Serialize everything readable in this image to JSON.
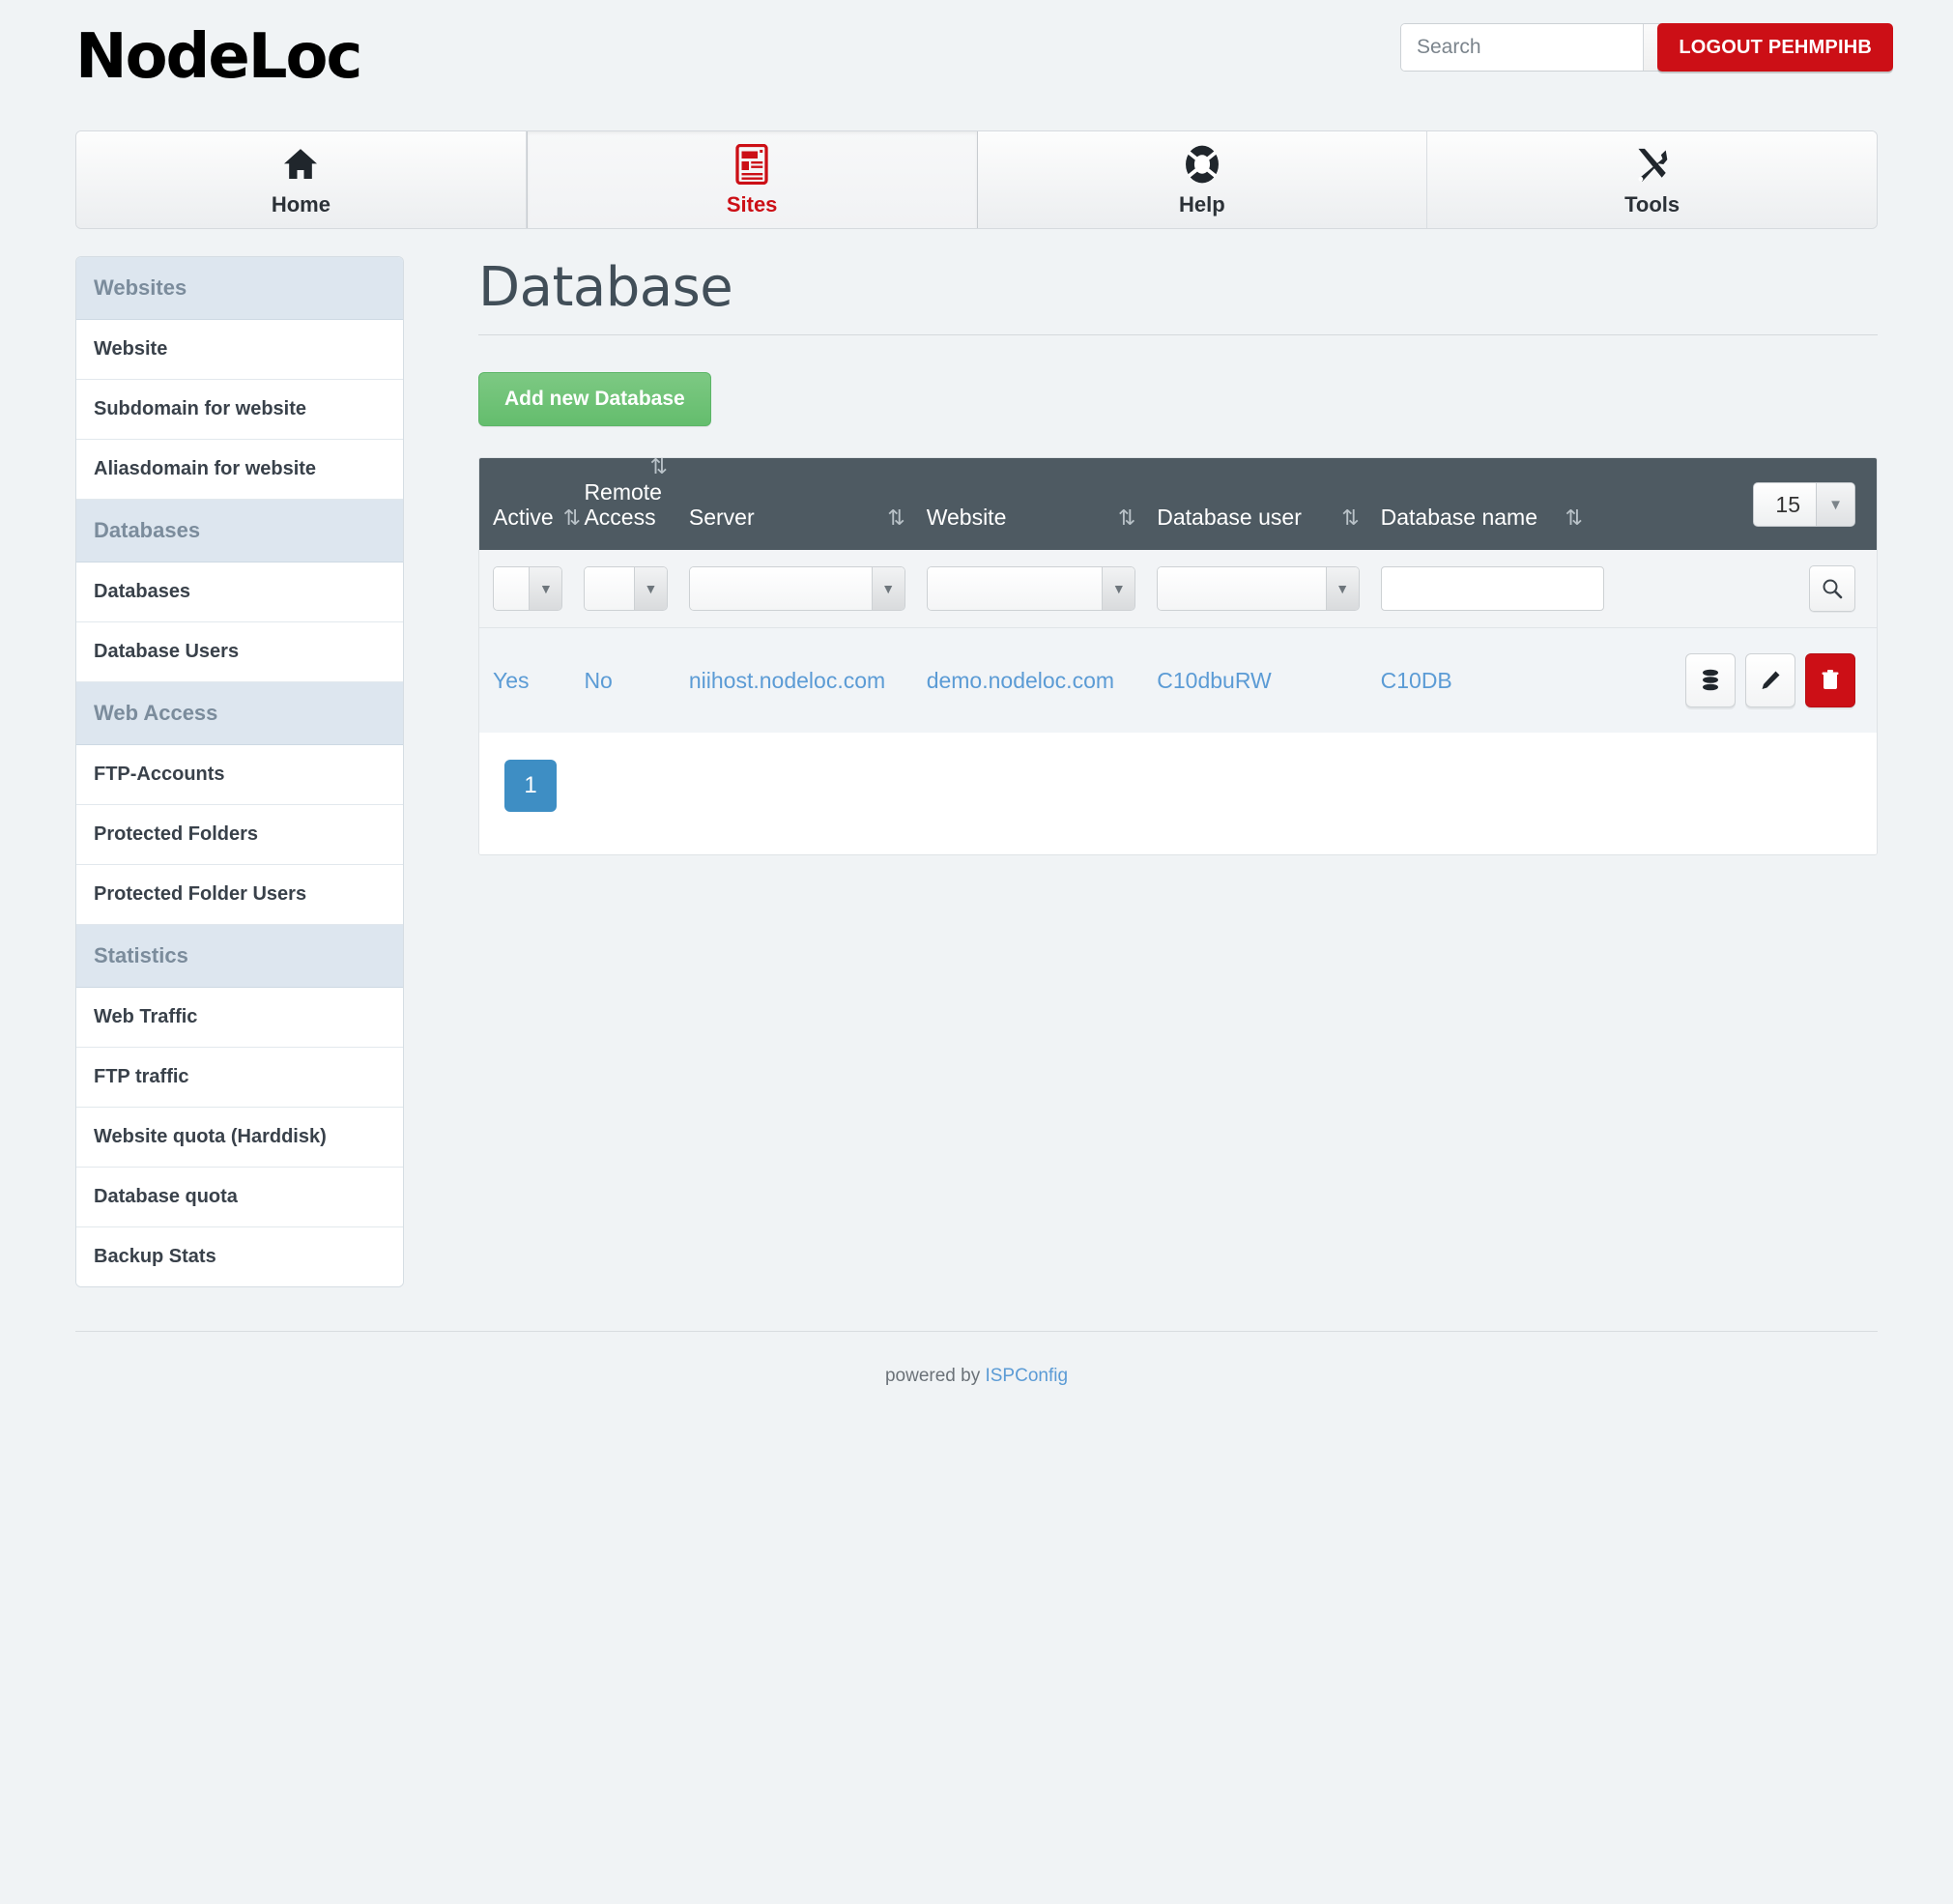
{
  "header": {
    "logo_text": "NodeLoc",
    "logo_letters": [
      "N",
      "o",
      "d",
      "e",
      "L",
      "o",
      "c"
    ],
    "search_placeholder": "Search",
    "search_value": "",
    "search_icon": "search-icon",
    "logout_label": "LOGOUT PEHMPIHB"
  },
  "nav": {
    "tabs": [
      {
        "label": "Home",
        "icon": "home-icon",
        "active": false
      },
      {
        "label": "Sites",
        "icon": "document-icon",
        "active": true
      },
      {
        "label": "Help",
        "icon": "lifebuoy-icon",
        "active": false
      },
      {
        "label": "Tools",
        "icon": "tools-icon",
        "active": false
      }
    ]
  },
  "sidebar": {
    "groups": [
      {
        "title": "Websites",
        "items": [
          "Website",
          "Subdomain for website",
          "Aliasdomain for website"
        ]
      },
      {
        "title": "Databases",
        "items": [
          "Databases",
          "Database Users"
        ]
      },
      {
        "title": "Web Access",
        "items": [
          "FTP-Accounts",
          "Protected Folders",
          "Protected Folder Users"
        ]
      },
      {
        "title": "Statistics",
        "items": [
          "Web Traffic",
          "FTP traffic",
          "Website quota (Harddisk)",
          "Database quota",
          "Backup Stats"
        ]
      }
    ]
  },
  "main": {
    "page_title": "Database",
    "add_button_label": "Add new Database",
    "table": {
      "columns": [
        {
          "label": "Active",
          "sort_icon": "sort-icon"
        },
        {
          "label": "Remote Access",
          "sort_icon": "sort-icon"
        },
        {
          "label": "Server",
          "sort_icon": "sort-icon"
        },
        {
          "label": "Website",
          "sort_icon": "sort-icon"
        },
        {
          "label": "Database user",
          "sort_icon": "sort-icon"
        },
        {
          "label": "Database name",
          "sort_icon": "sort-icon"
        }
      ],
      "page_size_value": "15",
      "page_size_icon": "chevron-down-icon",
      "filters": {
        "active": "",
        "remote_access": "",
        "server": "",
        "website": "",
        "database_user": "",
        "database_name": "",
        "search_icon": "search-icon"
      },
      "rows": [
        {
          "active": "Yes",
          "remote_access": "No",
          "server": "niihost.nodeloc.com",
          "website": "demo.nodeloc.com",
          "database_user": "C10dbuRW",
          "database_name": "C10DB",
          "actions": [
            "database-icon",
            "edit-pencil-icon",
            "delete-trash-icon"
          ]
        }
      ]
    },
    "pagination": {
      "current_page": "1"
    }
  },
  "footer": {
    "text": "powered by ",
    "link_label": "ISPConfig"
  },
  "colors": {
    "accent_red": "#cc0f16",
    "link_blue": "#5b9bd5",
    "table_header": "#4e5a62",
    "group_header": "#dde6ef",
    "add_green": "#64bd6d",
    "page_bg": "#f0f3f5"
  }
}
